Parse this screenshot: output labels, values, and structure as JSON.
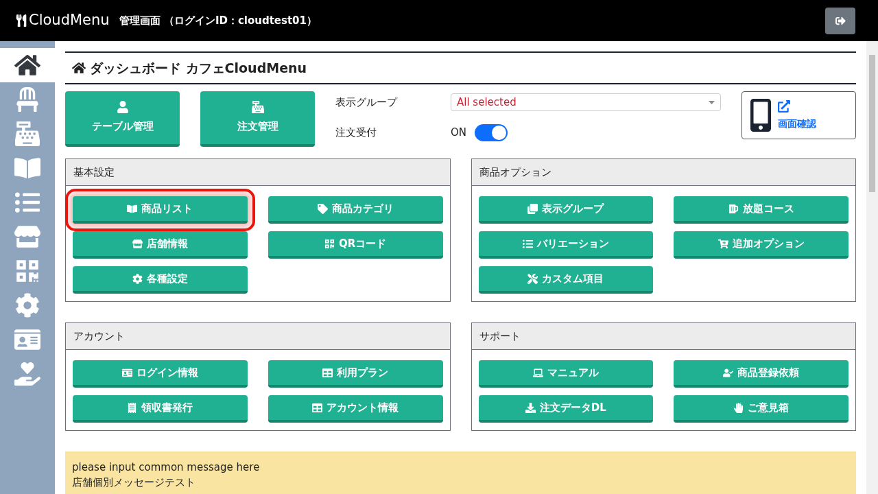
{
  "header": {
    "logo": "CloudMenu",
    "title": "管理画面 （ログインID：cloudtest01）"
  },
  "sidebar": {
    "items": [
      {
        "selected": true
      },
      {
        "selected": false
      },
      {
        "selected": false
      },
      {
        "selected": false
      },
      {
        "selected": false
      },
      {
        "selected": false
      },
      {
        "selected": false
      },
      {
        "selected": false
      },
      {
        "selected": false
      },
      {
        "selected": false
      }
    ]
  },
  "page_title": "ダッシュボード カフェCloudMenu",
  "top_buttons": [
    {
      "label": "テーブル管理"
    },
    {
      "label": "注文管理"
    }
  ],
  "display_group": {
    "label": "表示グループ",
    "value": "All selected"
  },
  "order_accept": {
    "label": "注文受付",
    "state_text": "ON",
    "on": true
  },
  "preview": {
    "label": "画面確認"
  },
  "sections": [
    {
      "title": "基本設定",
      "buttons": [
        {
          "label": "商品リスト",
          "highlighted": true
        },
        {
          "label": "商品カテゴリ",
          "highlighted": false
        },
        {
          "label": "店舗情報",
          "highlighted": false
        },
        {
          "label": "QRコード",
          "highlighted": false
        },
        {
          "label": "各種設定",
          "highlighted": false
        }
      ]
    },
    {
      "title": "商品オプション",
      "buttons": [
        {
          "label": "表示グループ",
          "highlighted": false
        },
        {
          "label": "放題コース",
          "highlighted": false
        },
        {
          "label": "バリエーション",
          "highlighted": false
        },
        {
          "label": "追加オプション",
          "highlighted": false
        },
        {
          "label": "カスタム項目",
          "highlighted": false
        }
      ]
    },
    {
      "title": "アカウント",
      "buttons": [
        {
          "label": "ログイン情報",
          "highlighted": false
        },
        {
          "label": "利用プラン",
          "highlighted": false
        },
        {
          "label": "領収書発行",
          "highlighted": false
        },
        {
          "label": "アカウント情報",
          "highlighted": false
        }
      ]
    },
    {
      "title": "サポート",
      "buttons": [
        {
          "label": "マニュアル",
          "highlighted": false
        },
        {
          "label": "商品登録依頼",
          "highlighted": false
        },
        {
          "label": "注文データDL",
          "highlighted": false
        },
        {
          "label": "ご意見箱",
          "highlighted": false
        }
      ]
    }
  ],
  "message": {
    "lines": [
      "please input common message here",
      "店舗個別メッセージテスト"
    ]
  }
}
